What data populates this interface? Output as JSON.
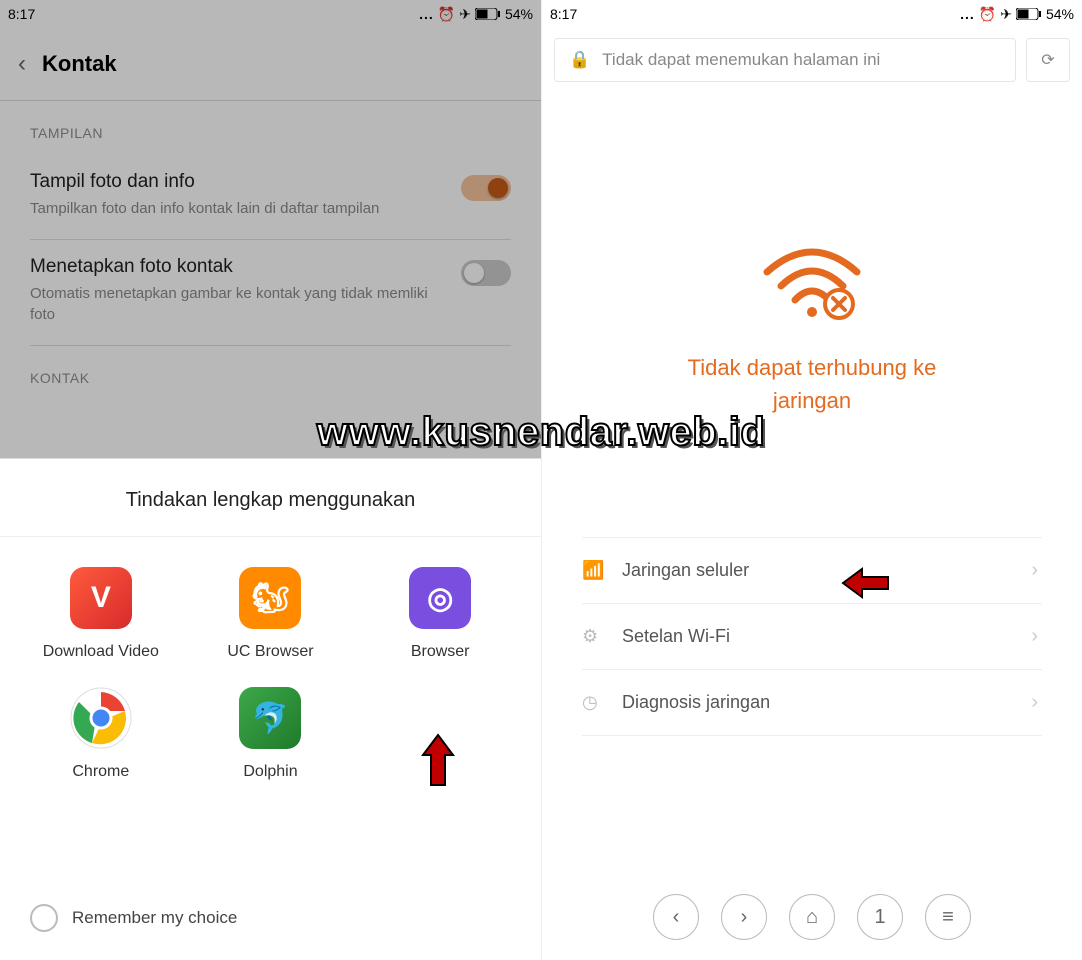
{
  "status": {
    "time": "8:17",
    "battery": "54%"
  },
  "left": {
    "header_title": "Kontak",
    "section_label": "TAMPILAN",
    "setting1": {
      "title": "Tampil foto dan info",
      "sub": "Tampilkan foto dan info kontak lain di daftar tampilan",
      "on": true
    },
    "setting2": {
      "title": "Menetapkan foto kontak",
      "sub": "Otomatis menetapkan gambar ke kontak yang tidak memliki foto",
      "on": false
    },
    "section2_label": "KONTAK",
    "sheet": {
      "title": "Tindakan lengkap menggunakan",
      "apps": [
        {
          "label": "Download Video",
          "bg": "linear-gradient(135deg,#ff5a3c,#d62c2c)",
          "glyph": "V"
        },
        {
          "label": "UC Browser",
          "bg": "#ff8a00",
          "glyph": "🐿"
        },
        {
          "label": "Browser",
          "bg": "#7a4fe0",
          "glyph": "◎"
        },
        {
          "label": "Chrome",
          "bg": "#fff",
          "glyph": "chrome"
        },
        {
          "label": "Dolphin",
          "bg": "linear-gradient(135deg,#3da84a,#1f7a2b)",
          "glyph": "🐬"
        }
      ],
      "remember": "Remember my choice"
    }
  },
  "right": {
    "addr": "Tidak dapat menemukan halaman ini",
    "error_title_line1": "Tidak dapat terhubung ke",
    "error_title_line2": "jaringan",
    "options": [
      {
        "icon": "📶",
        "label": "Jaringan seluler"
      },
      {
        "icon": "⚙",
        "label": "Setelan Wi-Fi"
      },
      {
        "icon": "◷",
        "label": "Diagnosis jaringan"
      }
    ],
    "nav": {
      "tabs": "1"
    }
  },
  "watermark": "www.kusnendar.web.id"
}
